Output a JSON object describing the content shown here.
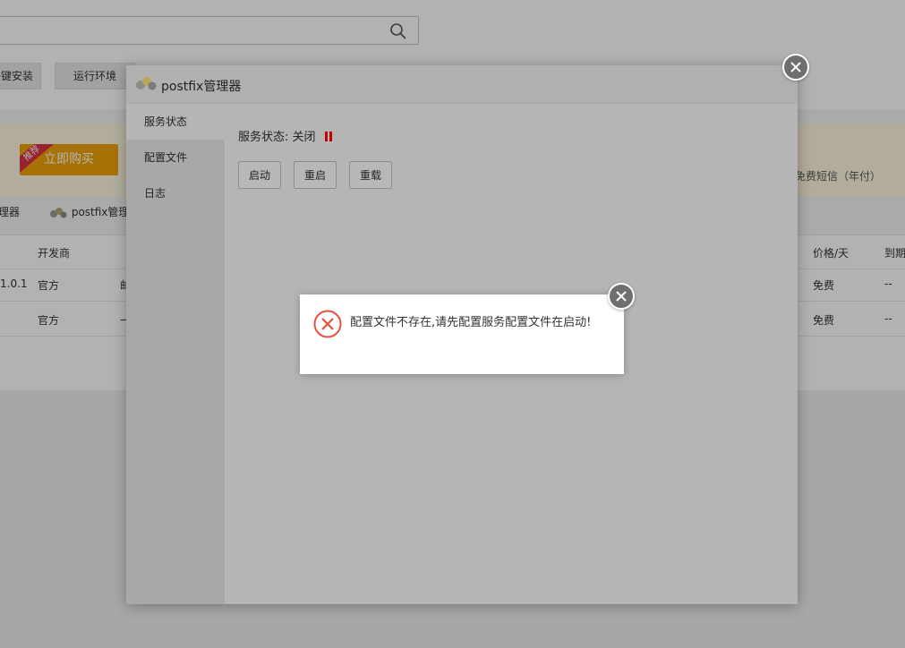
{
  "background": {
    "categories": [
      "一键安装",
      "运行环境"
    ],
    "buy_button": "立即购买",
    "buy_ribbon": "推荐",
    "sms_text": "免费短信（年付）",
    "plugin_tabs": [
      "理器",
      "postfix管理"
    ],
    "table": {
      "headers": [
        "开发商",
        "价格/天",
        "到期"
      ],
      "rows": [
        {
          "version": "1.0.1",
          "developer": "官方",
          "desc": "邮",
          "price": "免费",
          "expire": "--"
        },
        {
          "version": "",
          "developer": "官方",
          "desc": "一",
          "price": "免费",
          "expire": "--"
        }
      ]
    }
  },
  "dialog": {
    "title": "postfix管理器",
    "sidebar": [
      "服务状态",
      "配置文件",
      "日志"
    ],
    "status_label": "服务状态: 关闭",
    "buttons": {
      "start": "启动",
      "restart": "重启",
      "reload": "重载"
    }
  },
  "message": {
    "text": "配置文件不存在,请先配置服务配置文件在启动!"
  },
  "colors": {
    "error_red": "#e8513e",
    "status_red": "#c40000",
    "buy_orange": "#f0a30a"
  },
  "icons": {
    "search": "search-icon",
    "close": "close-icon",
    "error": "error-circle-icon",
    "pause": "pause-icon",
    "plugin": "postfix-logo-icon"
  }
}
